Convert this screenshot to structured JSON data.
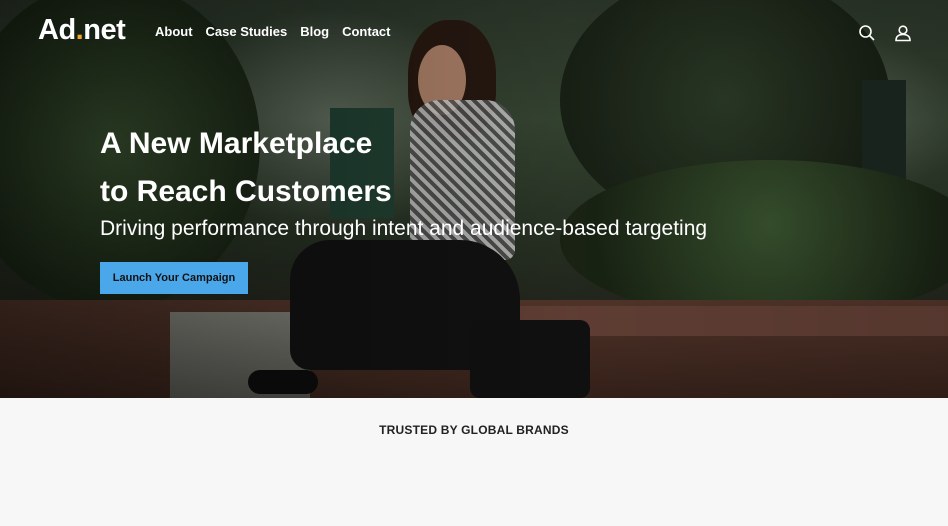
{
  "header": {
    "logo": {
      "text_main": "Ad",
      "text_dot": ".",
      "text_end": "net"
    },
    "nav": [
      {
        "label": "About"
      },
      {
        "label": "Case Studies"
      },
      {
        "label": "Blog"
      },
      {
        "label": "Contact"
      }
    ],
    "icons": [
      "search-icon",
      "user-icon"
    ]
  },
  "hero": {
    "title_line1": "A New Marketplace",
    "title_line2": "to Reach Customers",
    "subtitle": "Driving performance through intent and audience-based targeting",
    "cta_label": "Launch Your Campaign"
  },
  "trusted": {
    "label": "TRUSTED BY GLOBAL BRANDS"
  },
  "colors": {
    "accent": "#4aa8ea",
    "logo_dot": "#f5a623",
    "section_bg": "#f7f7f7"
  }
}
